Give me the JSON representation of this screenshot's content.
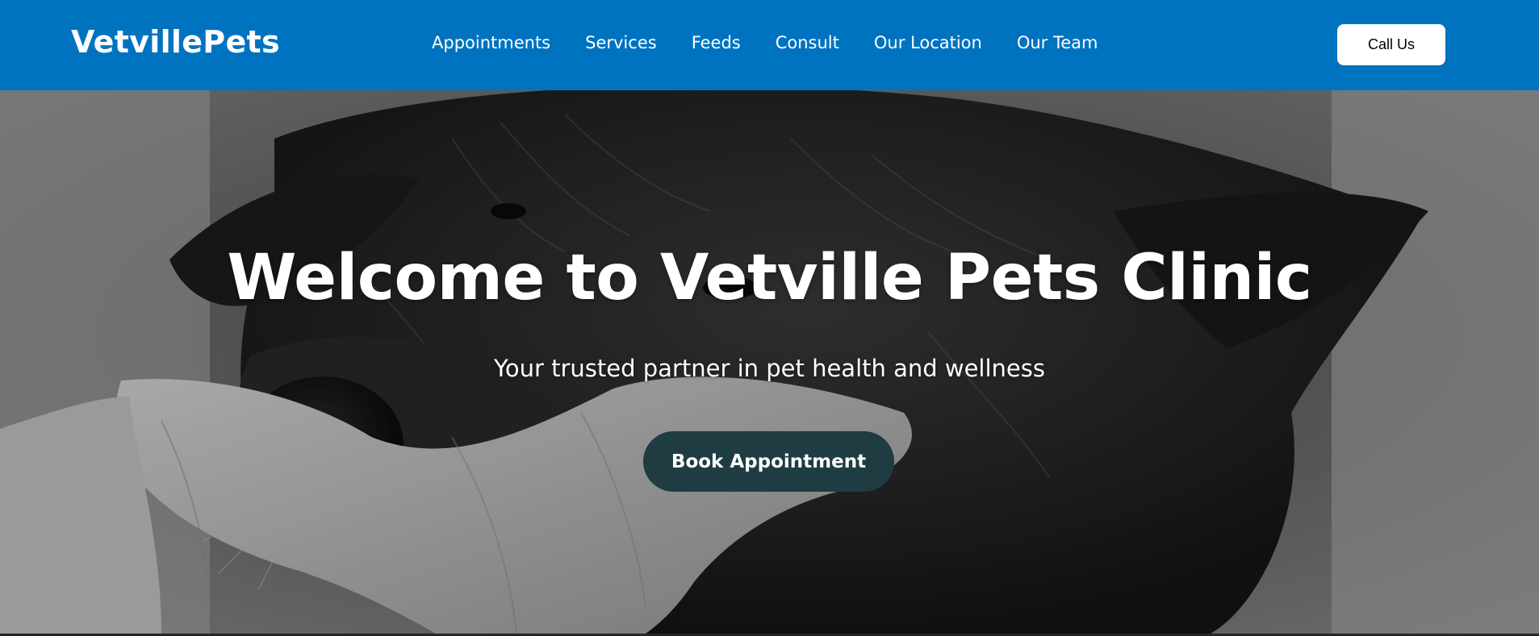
{
  "header": {
    "brand": "VetvillePets",
    "nav": [
      {
        "label": "Appointments"
      },
      {
        "label": "Services"
      },
      {
        "label": "Feeds"
      },
      {
        "label": "Consult"
      },
      {
        "label": "Our Location"
      },
      {
        "label": "Our Team"
      }
    ],
    "call_label": "Call Us"
  },
  "hero": {
    "title": "Welcome to Vetville Pets Clinic",
    "subtitle": "Your trusted partner in pet health and wellness",
    "cta_label": "Book Appointment"
  },
  "colors": {
    "nav_bg": "#0073c0",
    "cta_bg": "#1f3c42",
    "call_bg": "#ffffff"
  }
}
